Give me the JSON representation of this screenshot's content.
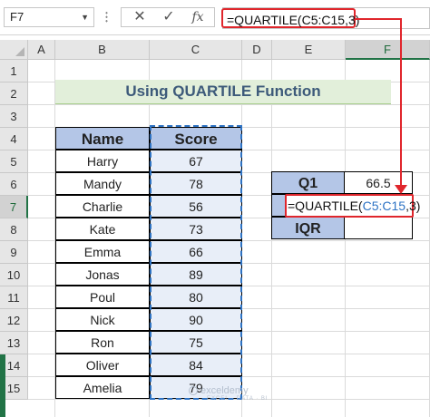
{
  "formula_bar": {
    "name_box": "F7",
    "cancel_glyph": "✕",
    "enter_glyph": "✓",
    "fx_glyph": "fx",
    "formula": "=QUARTILE(C5:C15,3)"
  },
  "columns": [
    "A",
    "B",
    "C",
    "D",
    "E",
    "F"
  ],
  "rows": [
    "1",
    "2",
    "3",
    "4",
    "5",
    "6",
    "7",
    "8",
    "9",
    "10",
    "11",
    "12",
    "13",
    "14",
    "15"
  ],
  "selected": {
    "column": "F",
    "row": "7"
  },
  "title": "Using QUARTILE Function",
  "score_table": {
    "headers": [
      "Name",
      "Score"
    ],
    "rows": [
      [
        "Harry",
        "67"
      ],
      [
        "Mandy",
        "78"
      ],
      [
        "Charlie",
        "56"
      ],
      [
        "Kate",
        "73"
      ],
      [
        "Emma",
        "66"
      ],
      [
        "Jonas",
        "89"
      ],
      [
        "Poul",
        "80"
      ],
      [
        "Nick",
        "90"
      ],
      [
        "Ron",
        "75"
      ],
      [
        "Oliver",
        "84"
      ],
      [
        "Amelia",
        "79"
      ]
    ]
  },
  "quartile_table": {
    "q1_label": "Q1",
    "q1_value": "66.5",
    "q3_formula_prefix": "=QUARTILE(",
    "q3_formula_ref": "C5:C15",
    "q3_formula_suffix": ",3)",
    "iqr_label": "IQR",
    "iqr_value": ""
  },
  "watermark": {
    "brand": "exceldemy",
    "tagline": "EXCEL · DATA · BI"
  },
  "colors": {
    "accent_red": "#e0262c",
    "header_blue": "#b4c6e7",
    "title_green": "#e2efda",
    "excel_green": "#217346",
    "range_blue": "#2e73c4"
  }
}
